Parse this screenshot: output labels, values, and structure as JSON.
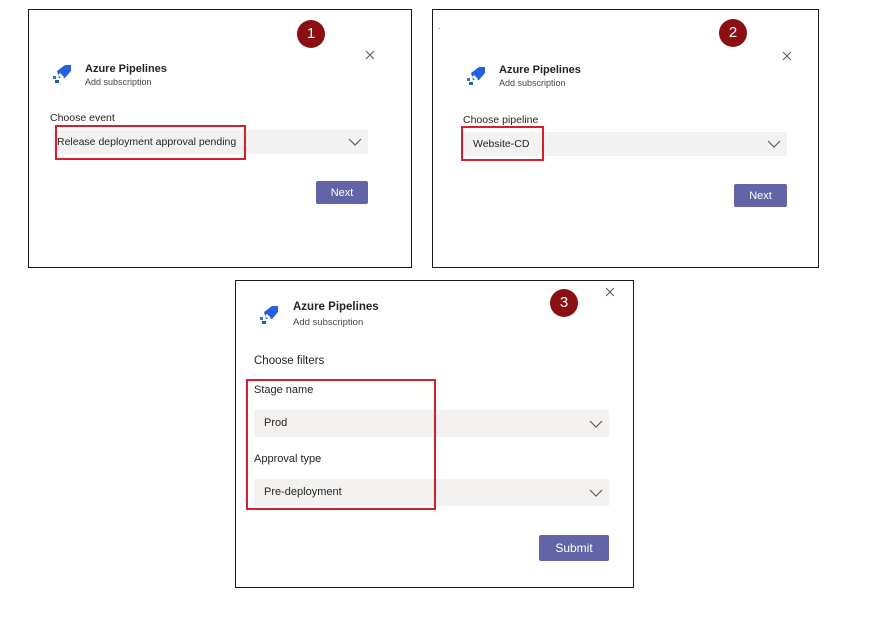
{
  "colors": {
    "accent": "#6264a7",
    "badge": "#8b0e12",
    "highlight": "#d8202c",
    "field_bg": "#f3f2f1"
  },
  "panel1": {
    "step": "1",
    "app_title": "Azure Pipelines",
    "app_subtitle": "Add subscription",
    "field_label": "Choose event",
    "field_value": "Release deployment approval pending",
    "button": "Next",
    "icons": [
      "azure-pipelines-logo",
      "close-icon",
      "chevron-down-icon"
    ]
  },
  "panel2": {
    "step": "2",
    "app_title": "Azure Pipelines",
    "app_subtitle": "Add subscription",
    "field_label": "Choose pipeline",
    "field_value": "Website-CD",
    "button": "Next",
    "icons": [
      "azure-pipelines-logo",
      "close-icon",
      "chevron-down-icon"
    ]
  },
  "panel3": {
    "step": "3",
    "app_title": "Azure Pipelines",
    "app_subtitle": "Add subscription",
    "section_title": "Choose filters",
    "stage_label": "Stage name",
    "stage_value": "Prod",
    "approval_label": "Approval type",
    "approval_value": "Pre-deployment",
    "button": "Submit",
    "icons": [
      "azure-pipelines-logo",
      "close-icon",
      "chevron-down-icon"
    ]
  }
}
